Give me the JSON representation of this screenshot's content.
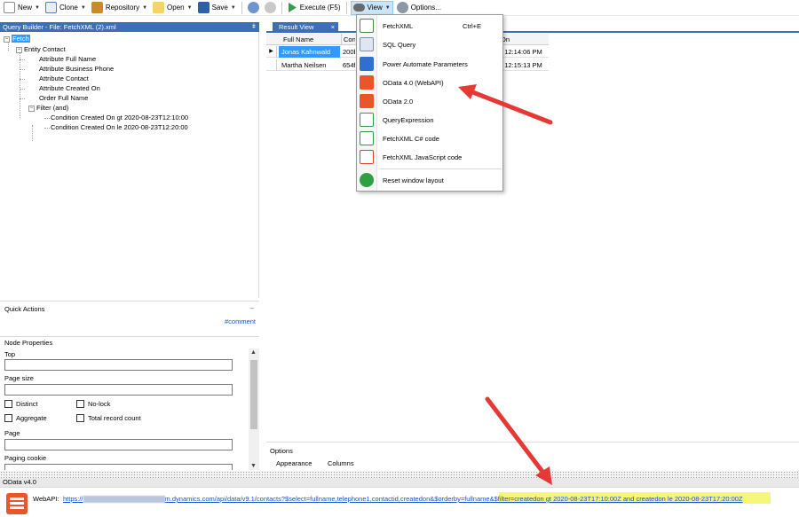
{
  "toolbar": {
    "new": "New",
    "clone": "Clone",
    "repository": "Repository",
    "open": "Open",
    "save": "Save",
    "execute": "Execute (F5)",
    "view": "View",
    "options": "Options..."
  },
  "left_panel": {
    "title": "Query Builder - File: FetchXML (2).xml",
    "tree": {
      "fetch": "Fetch",
      "entity": "Entity Contact",
      "attr_fullname": "Attribute Full Name",
      "attr_phone": "Attribute Business Phone",
      "attr_contact": "Attribute Contact",
      "attr_created": "Attribute Created On",
      "order": "Order Full Name",
      "filter": "Filter (and)",
      "cond1": "Condition Created On gt 2020-08-23T12:10:00",
      "cond2": "Condition Created On le 2020-08-23T12:20:00"
    }
  },
  "quick_actions": {
    "title": "Quick Actions",
    "minimize": "–",
    "link": "#comment"
  },
  "node_properties": {
    "title": "Node Properties",
    "top": "Top",
    "page_size": "Page size",
    "distinct": "Distinct",
    "nolock": "No-lock",
    "aggregate": "Aggregate",
    "total_record_count": "Total record count",
    "page": "Page",
    "paging_cookie": "Paging cookie"
  },
  "result": {
    "tab": "Result View",
    "tab_close": "×",
    "columns": [
      "Full Name",
      "Cont",
      "On"
    ],
    "rows": [
      {
        "name": "Jonas Kahnwald",
        "contact": "200b",
        "created": "0 12:14:06 PM"
      },
      {
        "name": "Martha Neilsen",
        "contact": "654f",
        "created": "0 12:15:13 PM"
      }
    ]
  },
  "options_panel": {
    "title": "Options",
    "tab_appearance": "Appearance",
    "tab_columns": "Columns"
  },
  "odata_panel": {
    "title": "OData v4.0",
    "label": "WebAPI:",
    "url_prefix": "https://",
    "url_main": "m.dynamics.com/api/data/v9.1/contacts?$select=fullname,telephone1,contactid,createdon&$orderby=fullname&",
    "url_filter": "$filter=createdon gt 2020-08-23T17:10:00Z and createdon le 2020-08-23T17:20:00Z"
  },
  "view_menu": {
    "items": [
      {
        "label": "FetchXML",
        "shortcut": "Ctrl+E"
      },
      {
        "label": "SQL Query"
      },
      {
        "label": "Power Automate Parameters"
      },
      {
        "label": "OData 4.0 (WebAPI)"
      },
      {
        "label": "OData 2.0"
      },
      {
        "label": "QueryExpression"
      },
      {
        "label": "FetchXML C# code"
      },
      {
        "label": "FetchXML JavaScript code"
      },
      {
        "label": "Reset window layout"
      }
    ]
  },
  "colors": {
    "panel_blue": "#3d6fb6",
    "selection": "#3399ff",
    "arrow_red": "#e53935",
    "highlight_yellow": "#f5f77a",
    "odata_orange": "#e8562a"
  }
}
